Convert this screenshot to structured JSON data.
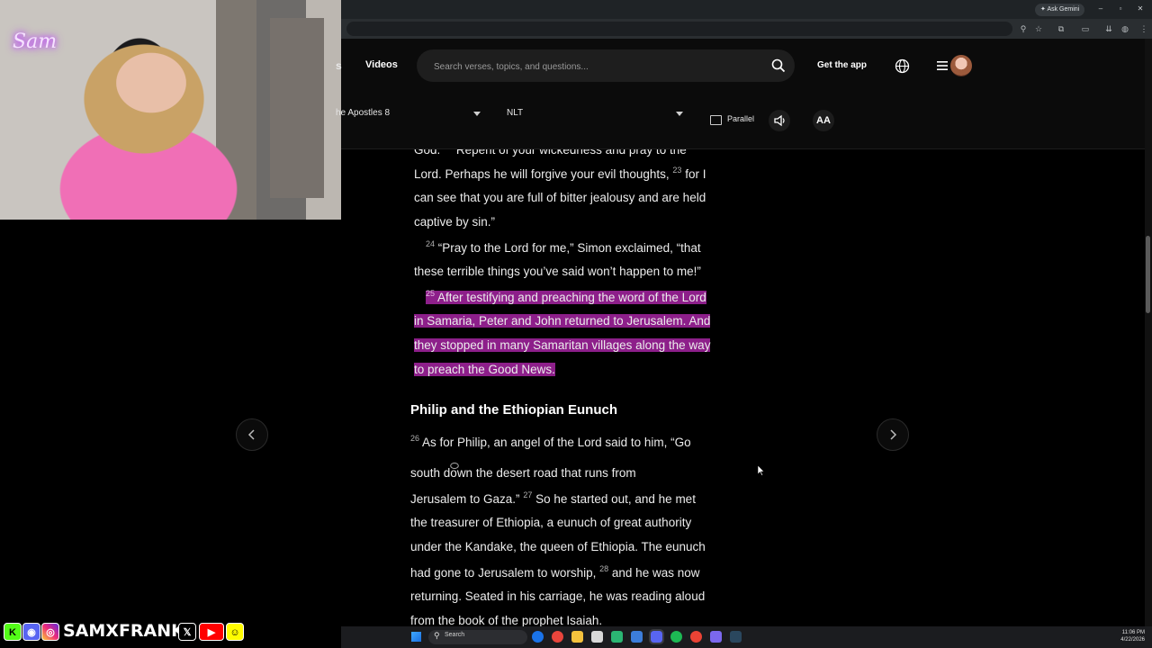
{
  "browser": {
    "ask_gemini": "Ask Gemini",
    "window_controls": [
      "–",
      "▫",
      "✕"
    ],
    "toolbar_icons": [
      "zoom-icon",
      "star-icon",
      "extensions-icon",
      "sidebar-icon",
      "downloads-icon",
      "profile-icon",
      "more-icon"
    ]
  },
  "header": {
    "nav_cut_label": "s",
    "nav_videos": "Videos",
    "search_placeholder": "Search verses, topics, and questions...",
    "get_app": "Get the app"
  },
  "reader_bar": {
    "book": "he Apostles 8",
    "version": "NLT",
    "parallel": "Parallel",
    "font_size": "AA"
  },
  "passage": {
    "lines": [
      {
        "pre": "God.",
        "vn": "22",
        "text": " Repent of your wickedness and pray to the"
      },
      {
        "text": "Lord. Perhaps he will forgive your evil thoughts,",
        "vn": "23",
        "post": " for I"
      },
      {
        "text": "can see that you are full of bitter jealousy and are held"
      },
      {
        "text": "captive by sin.”"
      },
      {
        "vn": "24",
        "text": " “Pray to the Lord for me,” Simon exclaimed, “that"
      },
      {
        "text": "these terrible things you’ve said won’t happen to me!”"
      },
      {
        "vn": "25",
        "text": " After testifying and preaching the word of the Lord"
      },
      {
        "text": "in Samaria, Peter and John returned to Jerusalem. And"
      },
      {
        "text": "they stopped in many Samaritan villages along the way"
      },
      {
        "text": "to preach the Good News."
      }
    ],
    "heading": "Philip and the Ethiopian Eunuch",
    "lines2": [
      {
        "vn": "26",
        "text": " As for Philip, an angel of the Lord said to him, “Go"
      },
      {
        "text": "south",
        "post": "  down the desert road that runs from"
      },
      {
        "text": "Jerusalem to Gaza.”",
        "vn": "27",
        "post": " So he started out, and he met"
      },
      {
        "text": "the treasurer of Ethiopia, a eunuch of great authority"
      },
      {
        "text": "under the Kandake, the queen of Ethiopia. The eunuch"
      },
      {
        "text": "had gone to Jerusalem to worship,",
        "vn": "28",
        "post": " and he was now"
      },
      {
        "text": "returning. Seated in his carriage, he was reading aloud"
      },
      {
        "text": "from the book of the prophet Isaiah."
      }
    ]
  },
  "overlay": {
    "logo": "Sam",
    "handle": "SAMXFRANK",
    "social_icons": [
      "kick-icon",
      "discord-icon",
      "instagram-icon",
      "x-icon",
      "youtube-icon",
      "snapchat-icon"
    ]
  },
  "taskbar": {
    "search": "Search",
    "time": "11:06 PM",
    "date": "4/22/2026"
  },
  "colors": {
    "highlight": "#8d1f8a",
    "background": "#000000"
  }
}
